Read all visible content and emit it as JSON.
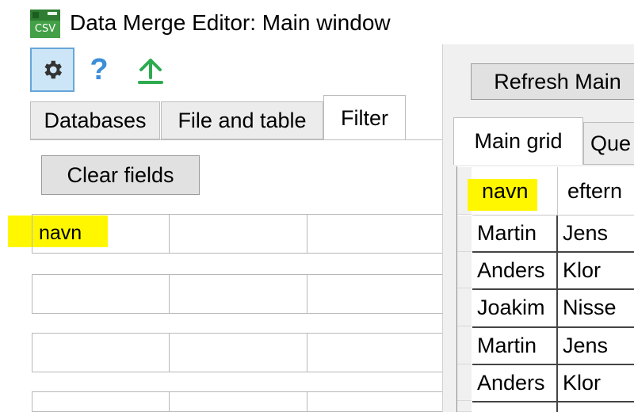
{
  "window": {
    "title": "Data Merge Editor: Main window",
    "app_icon_text": "CSV"
  },
  "toolbar": {
    "gear_icon": "gear-icon",
    "help_icon": "help-icon",
    "help_glyph": "?",
    "upload_icon": "upload-icon"
  },
  "left_tabs": [
    {
      "label": "Databases",
      "active": false
    },
    {
      "label": "File and table",
      "active": false
    },
    {
      "label": "Filter",
      "active": true
    }
  ],
  "filter": {
    "clear_label": "Clear fields",
    "rows": [
      [
        "navn",
        "",
        ""
      ],
      [
        "",
        "",
        ""
      ],
      [
        "",
        "",
        ""
      ],
      [
        "",
        "",
        ""
      ]
    ]
  },
  "right": {
    "refresh_label": "Refresh Main",
    "tabs": [
      {
        "label": "Main grid",
        "active": true
      },
      {
        "label": "Que",
        "active": false
      }
    ],
    "grid": {
      "headers": [
        "navn",
        "eftern"
      ],
      "rows": [
        [
          "Martin",
          "Jens"
        ],
        [
          "Anders",
          "Klor"
        ],
        [
          "Joakim",
          "Nisse"
        ],
        [
          "Martin",
          "Jens"
        ],
        [
          "Anders",
          "Klor"
        ]
      ]
    }
  },
  "colors": {
    "highlight": "#fff700",
    "accent": "#3b8ed8",
    "upload": "#2eaa4f"
  }
}
